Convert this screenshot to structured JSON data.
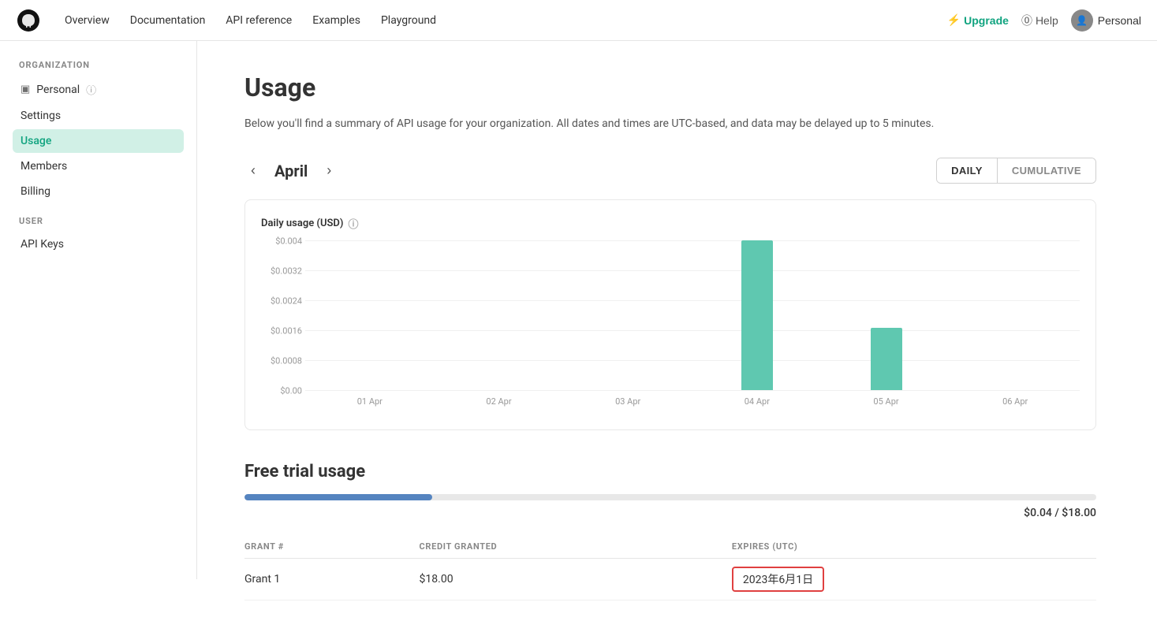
{
  "nav": {
    "links": [
      "Overview",
      "Documentation",
      "API reference",
      "Examples",
      "Playground"
    ],
    "upgrade_label": "Upgrade",
    "help_label": "Help",
    "personal_label": "Personal"
  },
  "sidebar": {
    "org_section": "ORGANIZATION",
    "user_section": "USER",
    "items": [
      {
        "id": "personal",
        "label": "Personal",
        "icon": "▣",
        "info": true
      },
      {
        "id": "settings",
        "label": "Settings",
        "icon": ""
      },
      {
        "id": "usage",
        "label": "Usage",
        "icon": "",
        "active": true
      },
      {
        "id": "members",
        "label": "Members",
        "icon": ""
      },
      {
        "id": "billing",
        "label": "Billing",
        "icon": ""
      },
      {
        "id": "api-keys",
        "label": "API Keys",
        "icon": ""
      }
    ]
  },
  "page": {
    "title": "Usage",
    "description": "Below you'll find a summary of API usage for your organization. All dates and times are UTC-based, and data may be delayed up to 5 minutes."
  },
  "chart": {
    "month": "April",
    "view_daily": "DAILY",
    "view_cumulative": "CUMULATIVE",
    "y_label": "Daily usage (USD)",
    "y_ticks": [
      "$0.004",
      "$0.0032",
      "$0.0024",
      "$0.0016",
      "$0.0008",
      "$0.00"
    ],
    "x_labels": [
      "01 Apr",
      "02 Apr",
      "03 Apr",
      "04 Apr",
      "05 Apr",
      "06 Apr"
    ],
    "bars": [
      0,
      0,
      0,
      1.0,
      0.42,
      0
    ],
    "max_value": 0.004
  },
  "free_trial": {
    "title": "Free trial usage",
    "progress_percent": 0.22,
    "progress_label": "$0.04 / $18.00",
    "table": {
      "headers": [
        "GRANT #",
        "CREDIT GRANTED",
        "EXPIRES (UTC)"
      ],
      "rows": [
        {
          "grant": "Grant 1",
          "credit": "$18.00",
          "expires": "2023年6月1日"
        }
      ]
    }
  }
}
